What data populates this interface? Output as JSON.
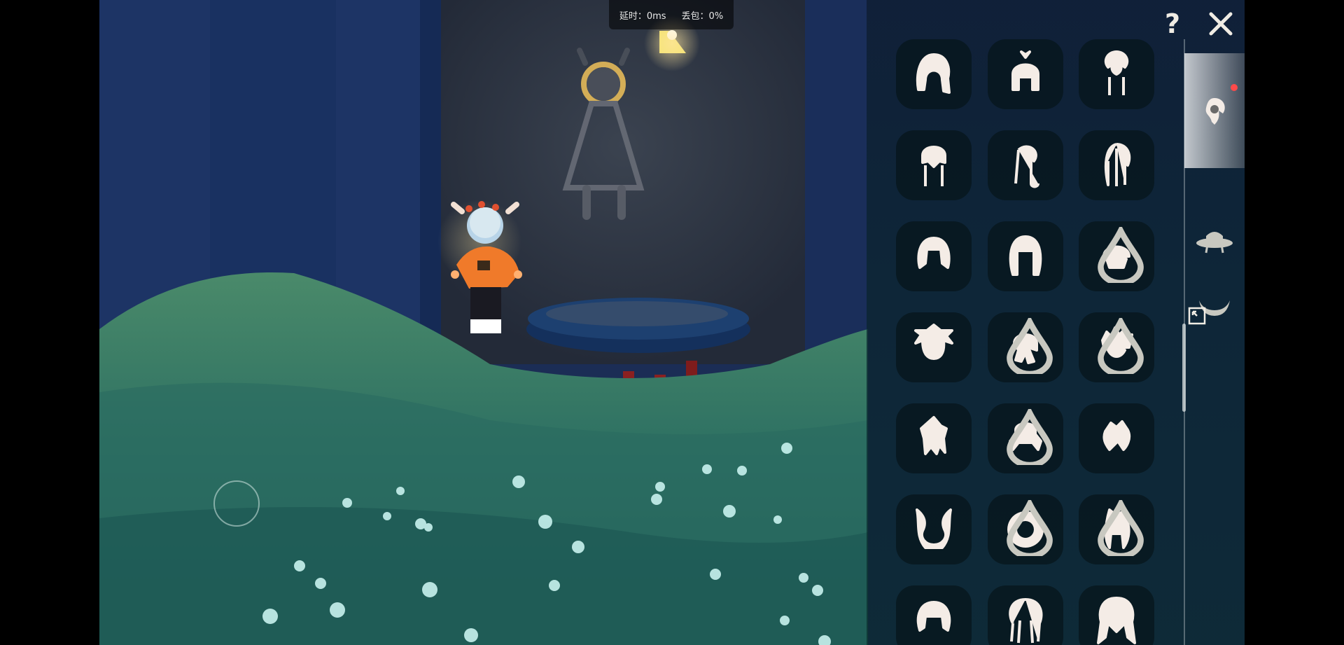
{
  "hud": {
    "latency_label": "延时：0ms",
    "packet_loss_label": "丢包：0%"
  },
  "colors": {
    "accent_orange": "#f07a2a",
    "notification_red": "#ff4a4a",
    "icon_cream": "#f4ece6",
    "panel_bg": "#0e1e34"
  },
  "panel": {
    "help_icon": "question-mark-icon",
    "help_label": "?",
    "close_icon": "close-x-icon",
    "tabs": [
      {
        "name": "hair",
        "icon": "hair-icon",
        "active": true,
        "notification": true
      },
      {
        "name": "hat",
        "icon": "hat-icon",
        "active": false,
        "notification": false
      },
      {
        "name": "horns",
        "icon": "horns-icon",
        "active": false,
        "notification": false
      }
    ],
    "hair_items": [
      {
        "icon": "hair-bob-braid-icon",
        "droplet": false
      },
      {
        "icon": "hair-crown-bun-icon",
        "droplet": false
      },
      {
        "icon": "hair-heart-braids-icon",
        "droplet": false
      },
      {
        "icon": "hair-twin-braids-icon",
        "droplet": false
      },
      {
        "icon": "hair-side-braid-icon",
        "droplet": false
      },
      {
        "icon": "hair-dreadlocks-icon",
        "droplet": false
      },
      {
        "icon": "hair-short-bob-icon",
        "droplet": false
      },
      {
        "icon": "hair-long-bob-icon",
        "droplet": false
      },
      {
        "icon": "hair-capped-icon",
        "droplet": true
      },
      {
        "icon": "hair-messy-icon",
        "droplet": false
      },
      {
        "icon": "hair-bandana-icon",
        "droplet": true
      },
      {
        "icon": "hair-spiky-icon",
        "droplet": true
      },
      {
        "icon": "hair-swept-icon",
        "droplet": false
      },
      {
        "icon": "hair-pigtails-icon",
        "droplet": true
      },
      {
        "icon": "hair-tuft-icon",
        "droplet": false
      },
      {
        "icon": "hair-bunny-icon",
        "droplet": false
      },
      {
        "icon": "hair-ornament-icon",
        "droplet": true
      },
      {
        "icon": "hair-fish-icon",
        "droplet": true
      },
      {
        "icon": "hair-bowl-icon",
        "droplet": false
      },
      {
        "icon": "hair-ribbon-braids-icon",
        "droplet": false
      },
      {
        "icon": "hair-flowing-icon",
        "droplet": false
      }
    ]
  }
}
